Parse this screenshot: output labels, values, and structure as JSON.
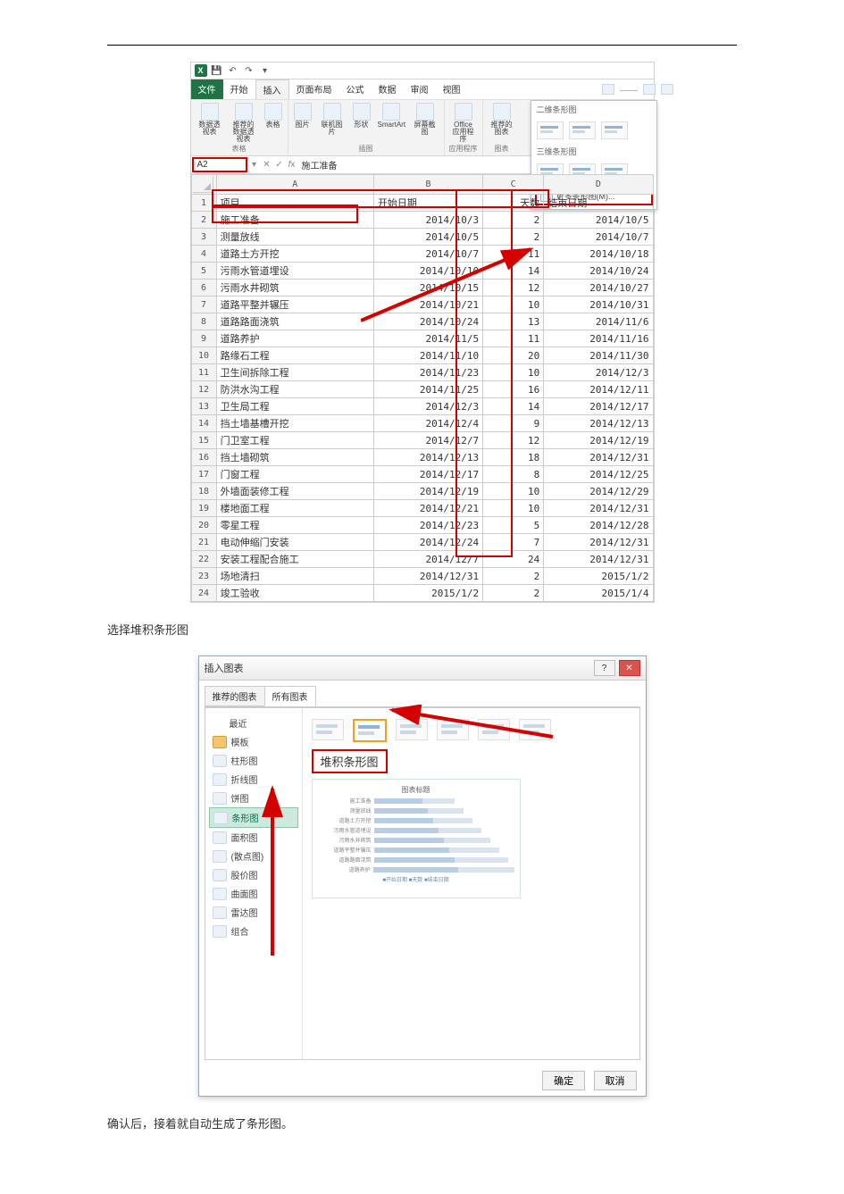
{
  "page_rule": "—",
  "namebox": "A2",
  "formula": "施工准备",
  "ribbon": {
    "tabs": [
      "文件",
      "开始",
      "插入",
      "页面布局",
      "公式",
      "数据",
      "审阅",
      "视图"
    ],
    "active_tab_index": 2,
    "groups": {
      "tables": {
        "pivot": "数据透视表",
        "recpivot": "推荐的数据透视表",
        "table": "表格",
        "label": "表格"
      },
      "illus": {
        "pic": "图片",
        "online": "联机图片",
        "shapes": "形状",
        "smartart": "SmartArt",
        "screenshot": "屏幕截图",
        "label": "插图"
      },
      "apps": {
        "office": "Office 应用程序",
        "label": "应用程序"
      },
      "charts": {
        "rec": "推荐的图表",
        "label": "图表"
      }
    },
    "chart_dropdown": {
      "bar2d": "二维条形图",
      "bar3d": "三维条形图",
      "more": "更多条形图(M)..."
    }
  },
  "sheet": {
    "col_headers": [
      "A",
      "B",
      "C",
      "D"
    ],
    "header_row": [
      "项目",
      "开始日期",
      "天数",
      "结束日期"
    ],
    "rows": [
      [
        "施工准备",
        "2014/10/3",
        "2",
        "2014/10/5"
      ],
      [
        "测量放线",
        "2014/10/5",
        "2",
        "2014/10/7"
      ],
      [
        "道路土方开挖",
        "2014/10/7",
        "11",
        "2014/10/18"
      ],
      [
        "污雨水管道埋设",
        "2014/10/10",
        "14",
        "2014/10/24"
      ],
      [
        "污雨水井砌筑",
        "2014/10/15",
        "12",
        "2014/10/27"
      ],
      [
        "道路平整并辗压",
        "2014/10/21",
        "10",
        "2014/10/31"
      ],
      [
        "道路路面浇筑",
        "2014/10/24",
        "13",
        "2014/11/6"
      ],
      [
        "道路养护",
        "2014/11/5",
        "11",
        "2014/11/16"
      ],
      [
        "路缘石工程",
        "2014/11/10",
        "20",
        "2014/11/30"
      ],
      [
        "卫生间拆除工程",
        "2014/11/23",
        "10",
        "2014/12/3"
      ],
      [
        "防洪水沟工程",
        "2014/11/25",
        "16",
        "2014/12/11"
      ],
      [
        "卫生局工程",
        "2014/12/3",
        "14",
        "2014/12/17"
      ],
      [
        "挡土墙基槽开挖",
        "2014/12/4",
        "9",
        "2014/12/13"
      ],
      [
        "门卫室工程",
        "2014/12/7",
        "12",
        "2014/12/19"
      ],
      [
        "挡土墙砌筑",
        "2014/12/13",
        "18",
        "2014/12/31"
      ],
      [
        "门窗工程",
        "2014/12/17",
        "8",
        "2014/12/25"
      ],
      [
        "外墙面装修工程",
        "2014/12/19",
        "10",
        "2014/12/29"
      ],
      [
        "楼地面工程",
        "2014/12/21",
        "10",
        "2014/12/31"
      ],
      [
        "零星工程",
        "2014/12/23",
        "5",
        "2014/12/28"
      ],
      [
        "电动伸缩门安装",
        "2014/12/24",
        "7",
        "2014/12/31"
      ],
      [
        "安装工程配合施工",
        "2014/12/7",
        "24",
        "2014/12/31"
      ],
      [
        "场地清扫",
        "2014/12/31",
        "2",
        "2015/1/2"
      ],
      [
        "竣工验收",
        "2015/1/2",
        "2",
        "2015/1/4"
      ]
    ]
  },
  "caption1": "选择堆积条形图",
  "dialog": {
    "title": "插入图表",
    "tabs": [
      "推荐的图表",
      "所有图表"
    ],
    "active_tab_index": 1,
    "left_items": [
      {
        "icon": "recent",
        "label": "最近"
      },
      {
        "icon": "folder",
        "label": "模板"
      },
      {
        "icon": "col",
        "label": "柱形图"
      },
      {
        "icon": "line",
        "label": "折线图"
      },
      {
        "icon": "pie",
        "label": "饼图"
      },
      {
        "icon": "bar",
        "label": "条形图",
        "selected": true
      },
      {
        "icon": "area",
        "label": "面积图"
      },
      {
        "icon": "xy",
        "label": "(散点图)"
      },
      {
        "icon": "stock",
        "label": "股价图"
      },
      {
        "icon": "surf",
        "label": "曲面图"
      },
      {
        "icon": "radar",
        "label": "雷达图"
      },
      {
        "icon": "combo",
        "label": "组合"
      }
    ],
    "chart_title": "堆积条形图",
    "preview_title": "图表标题",
    "preview_legend": "■开始日期 ■天数 ■结束日期",
    "preview_labels": [
      "施工准备",
      "测量放线",
      "道路土方开挖",
      "污雨水管道埋设",
      "污雨水井砌筑",
      "道路平整并辗压",
      "道路路面浇筑",
      "道路养护"
    ],
    "ok": "确定",
    "cancel": "取消"
  },
  "caption2": "确认后，接着就自动生成了条形图。",
  "chart_data": {
    "type": "bar",
    "note": "Gantt-style stacked bar source data",
    "categories": [
      "施工准备",
      "测量放线",
      "道路土方开挖",
      "污雨水管道埋设",
      "污雨水井砌筑",
      "道路平整并辗压",
      "道路路面浇筑",
      "道路养护",
      "路缘石工程",
      "卫生间拆除工程",
      "防洪水沟工程",
      "卫生局工程",
      "挡土墙基槽开挖",
      "门卫室工程",
      "挡土墙砌筑",
      "门窗工程",
      "外墙面装修工程",
      "楼地面工程",
      "零星工程",
      "电动伸缩门安装",
      "安装工程配合施工",
      "场地清扫",
      "竣工验收"
    ],
    "series": [
      {
        "name": "开始日期",
        "values": [
          "2014/10/3",
          "2014/10/5",
          "2014/10/7",
          "2014/10/10",
          "2014/10/15",
          "2014/10/21",
          "2014/10/24",
          "2014/11/5",
          "2014/11/10",
          "2014/11/23",
          "2014/11/25",
          "2014/12/3",
          "2014/12/4",
          "2014/12/7",
          "2014/12/13",
          "2014/12/17",
          "2014/12/19",
          "2014/12/21",
          "2014/12/23",
          "2014/12/24",
          "2014/12/7",
          "2014/12/31",
          "2015/1/2"
        ]
      },
      {
        "name": "天数",
        "values": [
          2,
          2,
          11,
          14,
          12,
          10,
          13,
          11,
          20,
          10,
          16,
          14,
          9,
          12,
          18,
          8,
          10,
          10,
          5,
          7,
          24,
          2,
          2
        ]
      },
      {
        "name": "结束日期",
        "values": [
          "2014/10/5",
          "2014/10/7",
          "2014/10/18",
          "2014/10/24",
          "2014/10/27",
          "2014/10/31",
          "2014/11/6",
          "2014/11/16",
          "2014/11/30",
          "2014/12/3",
          "2014/12/11",
          "2014/12/17",
          "2014/12/13",
          "2014/12/19",
          "2014/12/31",
          "2014/12/25",
          "2014/12/29",
          "2014/12/31",
          "2014/12/28",
          "2014/12/31",
          "2014/12/31",
          "2015/1/2",
          "2015/1/4"
        ]
      }
    ]
  }
}
